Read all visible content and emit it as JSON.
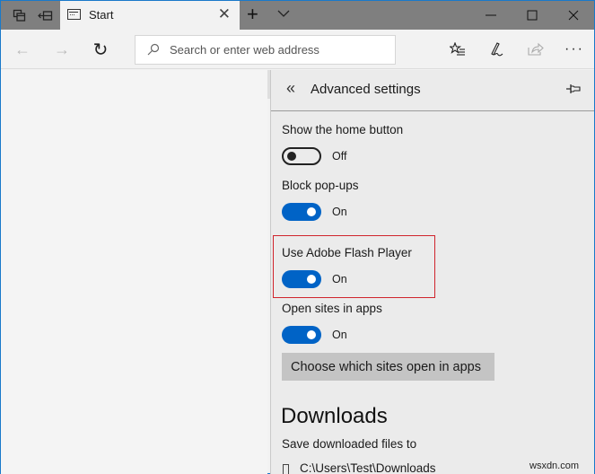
{
  "titlebar": {
    "tabs_aside_icon": "tabs-aside-icon",
    "restore_tabs_icon": "restore-tabs-icon",
    "tab": {
      "title": "Start",
      "icon": "start-page-icon",
      "close_glyph": "✕"
    },
    "new_tab_glyph": "+",
    "tab_dropdown_icon": "chevron-down-icon",
    "window_controls": {
      "minimize": "—",
      "maximize": "☐",
      "close": "✕"
    }
  },
  "navbar": {
    "back_glyph": "←",
    "forward_glyph": "→",
    "refresh_glyph": "↻",
    "address": {
      "placeholder": "Search or enter web address",
      "value": ""
    },
    "tools": {
      "favorites_glyph": "☆",
      "notes_glyph": "✎",
      "share_glyph": "⇪",
      "more_glyph": "···"
    }
  },
  "panel": {
    "back_glyph": "«",
    "title": "Advanced settings",
    "pin_icon": "pin-icon",
    "settings": [
      {
        "label": "Show the home button",
        "state": "Off",
        "on": false
      },
      {
        "label": "Block pop-ups",
        "state": "On",
        "on": true
      },
      {
        "label": "Use Adobe Flash Player",
        "state": "On",
        "on": true,
        "highlighted": true
      },
      {
        "label": "Open sites in apps",
        "state": "On",
        "on": true
      }
    ],
    "choose_sites_button": "Choose which sites open in apps",
    "downloads": {
      "heading": "Downloads",
      "label": "Save downloaded files to",
      "path": "C:\\Users\\Test\\Downloads"
    },
    "colors": {
      "toggle_on": "#0063c6",
      "highlight_border": "#d0242c"
    }
  },
  "watermark": "wsxdn.com"
}
